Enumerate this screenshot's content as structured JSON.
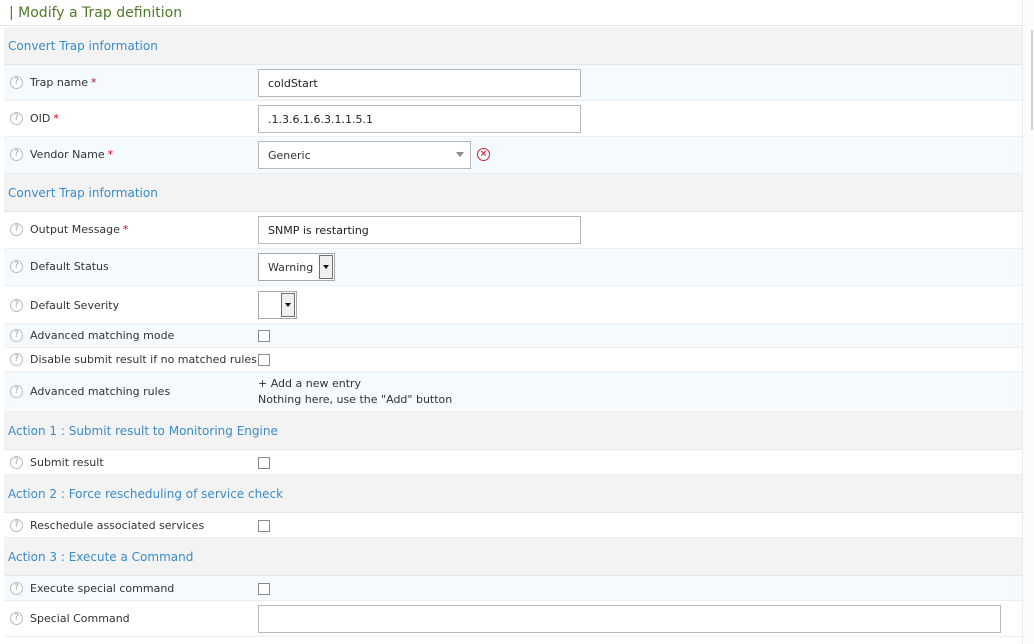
{
  "page": {
    "title": "| Modify a Trap definition"
  },
  "sections": {
    "s1": "Convert Trap information",
    "s2": "Convert Trap information",
    "s3": "Action 1 : Submit result to Monitoring Engine",
    "s4": "Action 2 : Force rescheduling of service check",
    "s5": "Action 3 : Execute a Command"
  },
  "fields": {
    "trap_name": {
      "label": "Trap name",
      "required": "*",
      "value": "coldStart"
    },
    "oid": {
      "label": "OID",
      "required": "*",
      "value": ".1.3.6.1.6.3.1.1.5.1"
    },
    "vendor_name": {
      "label": "Vendor Name",
      "required": "*",
      "value": "Generic"
    },
    "output_message": {
      "label": "Output Message",
      "required": "*",
      "value": "SNMP is restarting"
    },
    "default_status": {
      "label": "Default Status",
      "value": "Warning"
    },
    "default_severity": {
      "label": "Default Severity",
      "value": ""
    },
    "advanced_matching_mode": {
      "label": "Advanced matching mode",
      "checked": false
    },
    "disable_submit": {
      "label": "Disable submit result if no matched rules",
      "checked": false
    },
    "advanced_matching_rules": {
      "label": "Advanced matching rules",
      "add_link": "+ Add a new entry",
      "empty_text": "Nothing here, use the \"Add\" button"
    },
    "submit_result": {
      "label": "Submit result",
      "checked": false
    },
    "reschedule": {
      "label": "Reschedule associated services",
      "checked": false
    },
    "execute_special": {
      "label": "Execute special command",
      "checked": false
    },
    "special_command": {
      "label": "Special Command",
      "value": ""
    }
  },
  "icons": {
    "help": "help-icon",
    "clear": "clear-selection-icon",
    "dropdown": "chevron-down-icon"
  },
  "colors": {
    "title": "#4f7a28",
    "section_text": "#3a8cc8",
    "required": "#d9001b",
    "clear": "#d0243a"
  }
}
